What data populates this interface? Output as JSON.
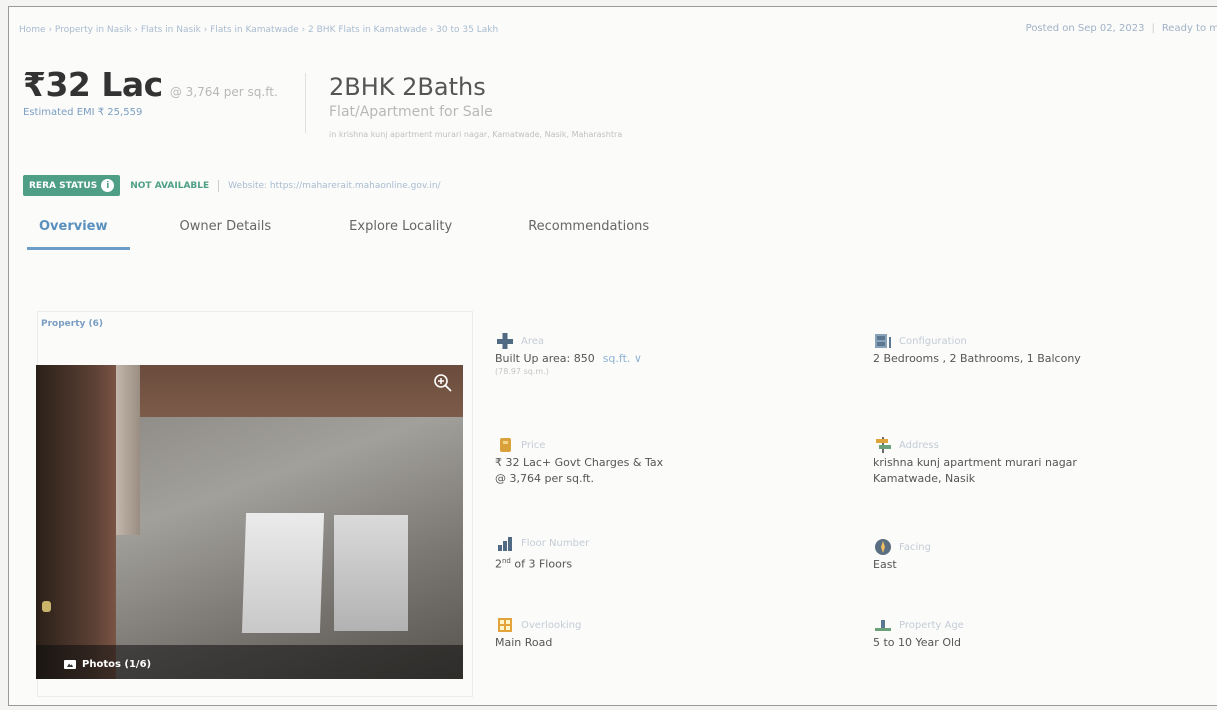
{
  "breadcrumb": "Home › Property in Nasik › Flats in Nasik › Flats in Kamatwade › 2 BHK Flats in Kamatwade › 30 to 35 Lakh",
  "posted": {
    "date": "Posted on Sep 02, 2023",
    "status": "Ready to m"
  },
  "price": {
    "amount": "₹32 Lac",
    "per_sqft": "@ 3,764 per sq.ft.",
    "emi": "Estimated EMI ₹ 25,559"
  },
  "listing": {
    "title": "2BHK 2Baths",
    "subtitle": "Flat/Apartment for Sale",
    "address": "in krishna kunj apartment murari nagar, Kamatwade, Nasik, Maharashtra"
  },
  "rera": {
    "badge": "RERA STATUS",
    "info_icon": "i",
    "status": "NOT AVAILABLE",
    "website": "Website: https://maharerait.mahaonline.gov.in/"
  },
  "tabs": [
    {
      "label": "Overview",
      "active": true
    },
    {
      "label": "Owner Details",
      "active": false
    },
    {
      "label": "Explore Locality",
      "active": false
    },
    {
      "label": "Recommendations",
      "active": false
    }
  ],
  "gallery": {
    "section_label": "Property (6)",
    "photos_label": "Photos (1/6)",
    "zoom_icon": "zoom-in-icon"
  },
  "details": {
    "area": {
      "label": "Area",
      "value": "Built Up area: 850",
      "unit": "sq.ft. ∨",
      "sub": "(78.97 sq.m.)",
      "icon": "area-icon"
    },
    "configuration": {
      "label": "Configuration",
      "value": "2 Bedrooms , 2 Bathrooms, 1 Balcony",
      "icon": "configuration-icon"
    },
    "price": {
      "label": "Price",
      "value": "₹ 32 Lac+ Govt Charges & Tax",
      "sub": "@ 3,764 per sq.ft.",
      "icon": "price-icon"
    },
    "address": {
      "label": "Address",
      "line1": "krishna kunj apartment murari nagar",
      "line2": "Kamatwade, Nasik",
      "icon": "address-icon"
    },
    "floor": {
      "label": "Floor Number",
      "value_num": "2",
      "value_sup": "nd",
      "value_rest": "of 3 Floors",
      "icon": "floor-icon"
    },
    "facing": {
      "label": "Facing",
      "value": "East",
      "icon": "compass-icon"
    },
    "overlooking": {
      "label": "Overlooking",
      "value": "Main Road",
      "icon": "overlooking-icon"
    },
    "age": {
      "label": "Property Age",
      "value": "5 to 10 Year Old",
      "icon": "property-age-icon"
    }
  },
  "colors": {
    "accent": "#5a90bd",
    "rera_green": "#4e9f86",
    "link": "#8fb4d6"
  }
}
